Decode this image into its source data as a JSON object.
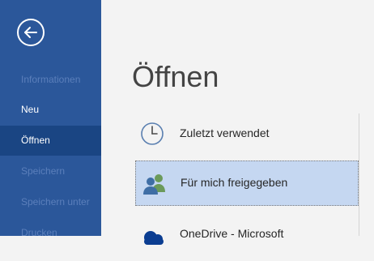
{
  "sidebar": {
    "back_button": "back",
    "items": [
      {
        "label": "Informationen",
        "state": "disabled"
      },
      {
        "label": "Neu",
        "state": "normal"
      },
      {
        "label": "Öffnen",
        "state": "selected"
      },
      {
        "label": "Speichern",
        "state": "disabled"
      },
      {
        "label": "Speichern unter",
        "state": "disabled"
      },
      {
        "label": "Drucken",
        "state": "disabled"
      }
    ]
  },
  "main": {
    "title": "Öffnen",
    "places": [
      {
        "label": "Zuletzt verwendet",
        "icon": "clock-icon"
      },
      {
        "label": "Für mich freigegeben",
        "icon": "shared-people-icon",
        "selected": true
      },
      {
        "label": "OneDrive - Microsoft",
        "icon": "onedrive-cloud-icon"
      }
    ]
  },
  "colors": {
    "sidebar_bg": "#2b579a",
    "sidebar_selected_bg": "#1a4583",
    "sidebar_disabled_text": "#5b7fbb",
    "main_bg": "#f3f3f3",
    "place_selected_bg": "#c5d7f1"
  }
}
